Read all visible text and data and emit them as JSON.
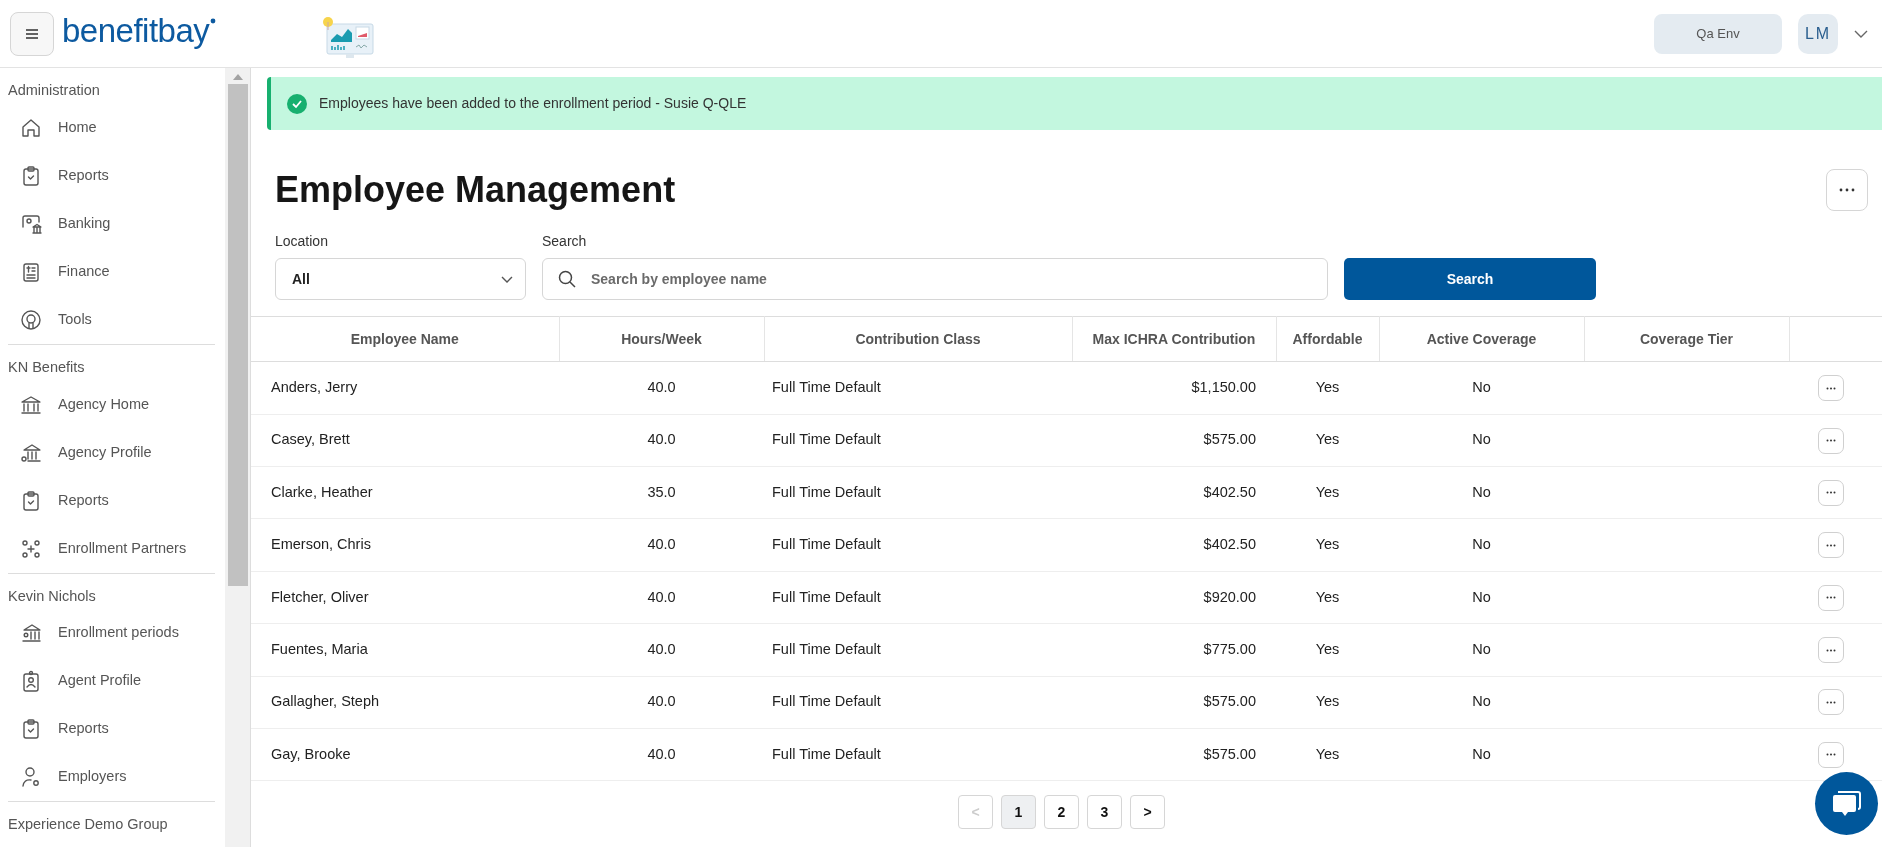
{
  "header": {
    "logo": "benefitbay",
    "environment_button": "Qa Env",
    "avatar_initials": "LM"
  },
  "sidebar": {
    "sections": [
      {
        "title": "Administration",
        "items": [
          {
            "label": "Home"
          },
          {
            "label": "Reports"
          },
          {
            "label": "Banking"
          },
          {
            "label": "Finance"
          },
          {
            "label": "Tools"
          }
        ]
      },
      {
        "title": "KN Benefits",
        "items": [
          {
            "label": "Agency Home"
          },
          {
            "label": "Agency Profile"
          },
          {
            "label": "Reports"
          },
          {
            "label": "Enrollment Partners"
          }
        ]
      },
      {
        "title": "Kevin Nichols",
        "items": [
          {
            "label": "Enrollment periods"
          },
          {
            "label": "Agent Profile"
          },
          {
            "label": "Reports"
          },
          {
            "label": "Employers"
          }
        ]
      },
      {
        "title": "Experience Demo Group"
      }
    ]
  },
  "alert": {
    "message": "Employees have been added to the enrollment period - Susie Q-QLE"
  },
  "page_title": "Employee Management",
  "filters": {
    "location_label": "Location",
    "location_value": "All",
    "search_label": "Search",
    "search_placeholder": "Search by employee name",
    "search_button": "Search"
  },
  "table": {
    "columns": [
      "Employee Name",
      "Hours/Week",
      "Contribution Class",
      "Max ICHRA Contribution",
      "Affordable",
      "Active Coverage",
      "Coverage Tier"
    ],
    "rows": [
      [
        "Anders, Jerry",
        "40.0",
        "Full Time Default",
        "$1,150.00",
        "Yes",
        "No"
      ],
      [
        "Casey, Brett",
        "40.0",
        "Full Time Default",
        "$575.00",
        "Yes",
        "No"
      ],
      [
        "Clarke, Heather",
        "35.0",
        "Full Time Default",
        "$402.50",
        "Yes",
        "No"
      ],
      [
        "Emerson, Chris",
        "40.0",
        "Full Time Default",
        "$402.50",
        "Yes",
        "No"
      ],
      [
        "Fletcher, Oliver",
        "40.0",
        "Full Time Default",
        "$920.00",
        "Yes",
        "No"
      ],
      [
        "Fuentes, Maria",
        "40.0",
        "Full Time Default",
        "$775.00",
        "Yes",
        "No"
      ],
      [
        "Gallagher, Steph",
        "40.0",
        "Full Time Default",
        "$575.00",
        "Yes",
        "No"
      ],
      [
        "Gay, Brooke",
        "40.0",
        "Full Time Default",
        "$575.00",
        "Yes",
        "No"
      ]
    ]
  },
  "pagination": [
    {
      "label": "<",
      "selected": false,
      "disabled": true
    },
    {
      "label": "1",
      "selected": true,
      "disabled": false
    },
    {
      "label": "2",
      "selected": false,
      "disabled": false
    },
    {
      "label": "3",
      "selected": false,
      "disabled": false
    },
    {
      "label": ">",
      "selected": false,
      "disabled": false
    }
  ]
}
